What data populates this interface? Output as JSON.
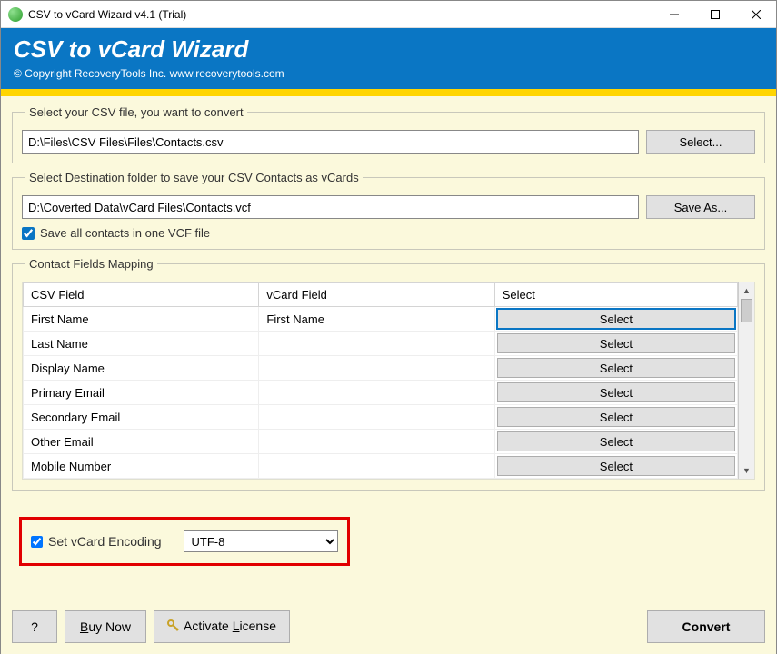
{
  "window": {
    "title": "CSV to vCard Wizard v4.1 (Trial)"
  },
  "header": {
    "title": "CSV to vCard Wizard",
    "copyright": "© Copyright RecoveryTools Inc. www.recoverytools.com"
  },
  "source": {
    "legend": "Select your CSV file, you want to convert",
    "path": "D:\\Files\\CSV Files\\Files\\Contacts.csv",
    "button": "Select..."
  },
  "dest": {
    "legend": "Select Destination folder to save your CSV Contacts as vCards",
    "path": "D:\\Coverted Data\\vCard Files\\Contacts.vcf",
    "button": "Save As...",
    "save_all_label": "Save all contacts in one VCF file",
    "save_all_checked": true
  },
  "mapping": {
    "legend": "Contact Fields Mapping",
    "columns": {
      "csv": "CSV Field",
      "vcard": "vCard Field",
      "select": "Select"
    },
    "select_label": "Select",
    "rows": [
      {
        "csv": "First Name",
        "vcard": "First Name",
        "focused": true
      },
      {
        "csv": "Last Name",
        "vcard": ""
      },
      {
        "csv": "Display Name",
        "vcard": ""
      },
      {
        "csv": "Primary Email",
        "vcard": ""
      },
      {
        "csv": "Secondary Email",
        "vcard": ""
      },
      {
        "csv": "Other Email",
        "vcard": ""
      },
      {
        "csv": "Mobile Number",
        "vcard": ""
      }
    ]
  },
  "encoding": {
    "label": "Set vCard Encoding",
    "value": "UTF-8",
    "checked": true
  },
  "footer": {
    "help": "?",
    "buy": "Buy Now",
    "activate": "Activate License",
    "convert": "Convert"
  }
}
